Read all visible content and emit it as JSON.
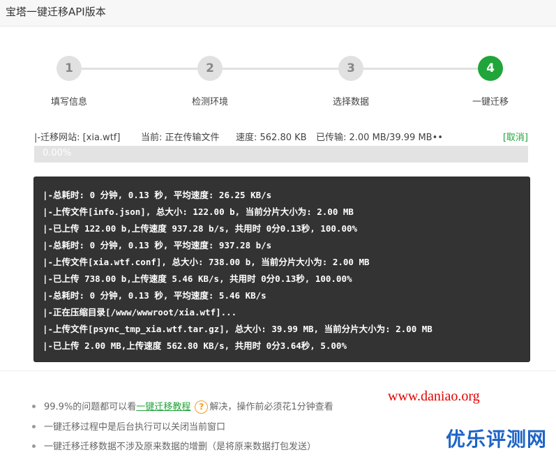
{
  "window": {
    "title": "宝塔一键迁移API版本"
  },
  "steps": [
    {
      "number": "1",
      "label": "填写信息",
      "active": false
    },
    {
      "number": "2",
      "label": "检测环境",
      "active": false
    },
    {
      "number": "3",
      "label": "选择数据",
      "active": false
    },
    {
      "number": "4",
      "label": "一键迁移",
      "active": true
    }
  ],
  "status": {
    "site": "|-迁移网站: [xia.wtf]",
    "current": "当前: 正在传输文件",
    "speed": "速度: 562.80 KB",
    "transferred": "已传输: 2.00 MB/39.99 MB••",
    "cancel": "[取消]"
  },
  "progress": {
    "text": "0.00%",
    "value": 0.0
  },
  "log": [
    "|-总耗时: 0 分钟, 0.13 秒, 平均速度: 26.25 KB/s",
    "|-上传文件[info.json], 总大小: 122.00 b, 当前分片大小为: 2.00 MB",
    "|-已上传 122.00 b,上传速度 937.28 b/s, 共用时 0分0.13秒,  100.00%",
    "|-总耗时: 0 分钟, 0.13 秒, 平均速度: 937.28 b/s",
    "|-上传文件[xia.wtf.conf], 总大小: 738.00 b, 当前分片大小为: 2.00 MB",
    "|-已上传 738.00 b,上传速度 5.46 KB/s, 共用时 0分0.13秒,  100.00%",
    "|-总耗时: 0 分钟, 0.13 秒, 平均速度: 5.46 KB/s",
    "|-正在压缩目录[/www/wwwroot/xia.wtf]...",
    "|-上传文件[psync_tmp_xia.wtf.tar.gz], 总大小: 39.99 MB, 当前分片大小为: 2.00 MB",
    "|-已上传 2.00 MB,上传速度 562.80 KB/s, 共用时 0分3.64秒,  5.00%"
  ],
  "tips": {
    "tip1_prefix": "99.9%的问题都可以看",
    "tip1_link": "一键迁移教程",
    "tip1_icon": "?",
    "tip1_suffix": "解决，操作前必须花1分钟查看",
    "tip2": "一键迁移过程中是后台执行可以关闭当前窗口",
    "tip3": "一键迁移迁移数据不涉及原来数据的增删（是将原来数据打包发送）"
  },
  "watermark": {
    "url": "www.daniao.org",
    "brand": "优乐评测网"
  },
  "colors": {
    "accent": "#20a53a",
    "console_bg": "#333333",
    "watermark_red": "#e10000",
    "watermark_blue": "#1d64c8"
  }
}
